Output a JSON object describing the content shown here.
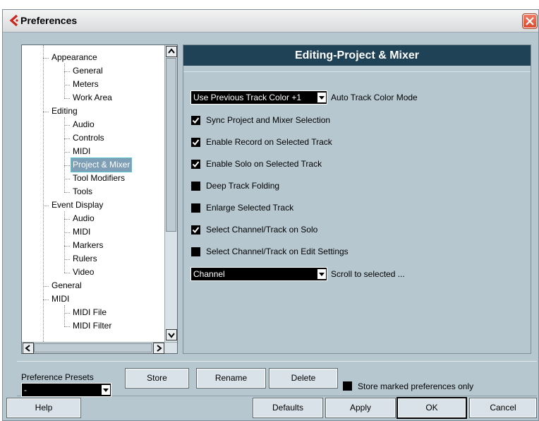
{
  "window": {
    "title": "Preferences"
  },
  "tree": {
    "items": [
      {
        "label": "Appearance",
        "level": 1
      },
      {
        "label": "General",
        "level": 2
      },
      {
        "label": "Meters",
        "level": 2
      },
      {
        "label": "Work Area",
        "level": 2
      },
      {
        "label": "Editing",
        "level": 1
      },
      {
        "label": "Audio",
        "level": 2
      },
      {
        "label": "Controls",
        "level": 2
      },
      {
        "label": "MIDI",
        "level": 2
      },
      {
        "label": "Project & Mixer",
        "level": 2,
        "selected": true
      },
      {
        "label": "Tool Modifiers",
        "level": 2
      },
      {
        "label": "Tools",
        "level": 2
      },
      {
        "label": "Event Display",
        "level": 1
      },
      {
        "label": "Audio",
        "level": 2
      },
      {
        "label": "MIDI",
        "level": 2
      },
      {
        "label": "Markers",
        "level": 2
      },
      {
        "label": "Rulers",
        "level": 2
      },
      {
        "label": "Video",
        "level": 2
      },
      {
        "label": "General",
        "level": 1
      },
      {
        "label": "MIDI",
        "level": 1
      },
      {
        "label": "MIDI File",
        "level": 2
      },
      {
        "label": "MIDI Filter",
        "level": 2
      }
    ]
  },
  "panel": {
    "title": "Editing-Project & Mixer",
    "track_color": {
      "value": "Use Previous Track Color +1",
      "caption": "Auto Track Color Mode"
    },
    "options": [
      {
        "label": "Sync Project and Mixer Selection",
        "checked": true
      },
      {
        "label": "Enable Record on Selected Track",
        "checked": true
      },
      {
        "label": "Enable Solo on Selected Track",
        "checked": true
      },
      {
        "label": "Deep Track Folding",
        "checked": false
      },
      {
        "label": "Enlarge Selected Track",
        "checked": false
      },
      {
        "label": "Select Channel/Track on Solo",
        "checked": true
      },
      {
        "label": "Select Channel/Track on Edit Settings",
        "checked": false
      }
    ],
    "scroll": {
      "value": "Channel",
      "caption": "Scroll to selected ..."
    }
  },
  "presets": {
    "label": "Preference Presets",
    "selected": "-",
    "store_label": "Store",
    "rename_label": "Rename",
    "delete_label": "Delete",
    "marked_only_label": "Store marked preferences only"
  },
  "footer": {
    "help_label": "Help",
    "defaults_label": "Defaults",
    "apply_label": "Apply",
    "ok_label": "OK",
    "cancel_label": "Cancel"
  },
  "colors": {
    "header_bg": "#1f4257",
    "dialog_bg": "#b6c7d0",
    "close_red": "#d94b2e"
  }
}
